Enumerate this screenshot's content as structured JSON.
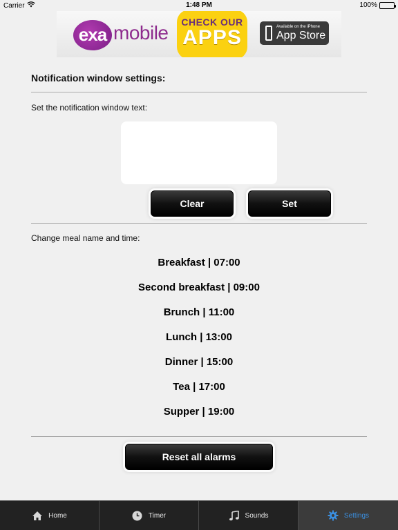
{
  "status_bar": {
    "carrier": "Carrier",
    "time": "1:48 PM",
    "battery": "100%",
    "battery_level": 1.0
  },
  "ad": {
    "logo_circle": "exa",
    "logo_text": "mobile",
    "apps_top": "CHECK OUR",
    "apps_main": "APPS",
    "store_small": "Available on the iPhone",
    "store_big": "App Store"
  },
  "notification": {
    "title": "Notification window settings:",
    "label": "Set the notification window text:",
    "text_value": "",
    "clear_label": "Clear",
    "set_label": "Set"
  },
  "meals": {
    "label": "Change meal name and time:",
    "items": [
      "Breakfast | 07:00",
      "Second breakfast | 09:00",
      "Brunch | 11:00",
      "Lunch | 13:00",
      "Dinner | 15:00",
      "Tea | 17:00",
      "Supper | 19:00"
    ]
  },
  "reset_label": "Reset all alarms",
  "tabs": [
    {
      "label": "Home",
      "icon": "home-icon"
    },
    {
      "label": "Timer",
      "icon": "clock-icon"
    },
    {
      "label": "Sounds",
      "icon": "music-note-icon"
    },
    {
      "label": "Settings",
      "icon": "gear-icon",
      "active": true
    }
  ],
  "colors": {
    "active_tab_text": "#3b8fe0",
    "tab_bar_bg": "#222222",
    "page_bg": "#f0f0f0",
    "ad_purple": "#8e2c8e",
    "ad_yellow": "#fbd111"
  }
}
